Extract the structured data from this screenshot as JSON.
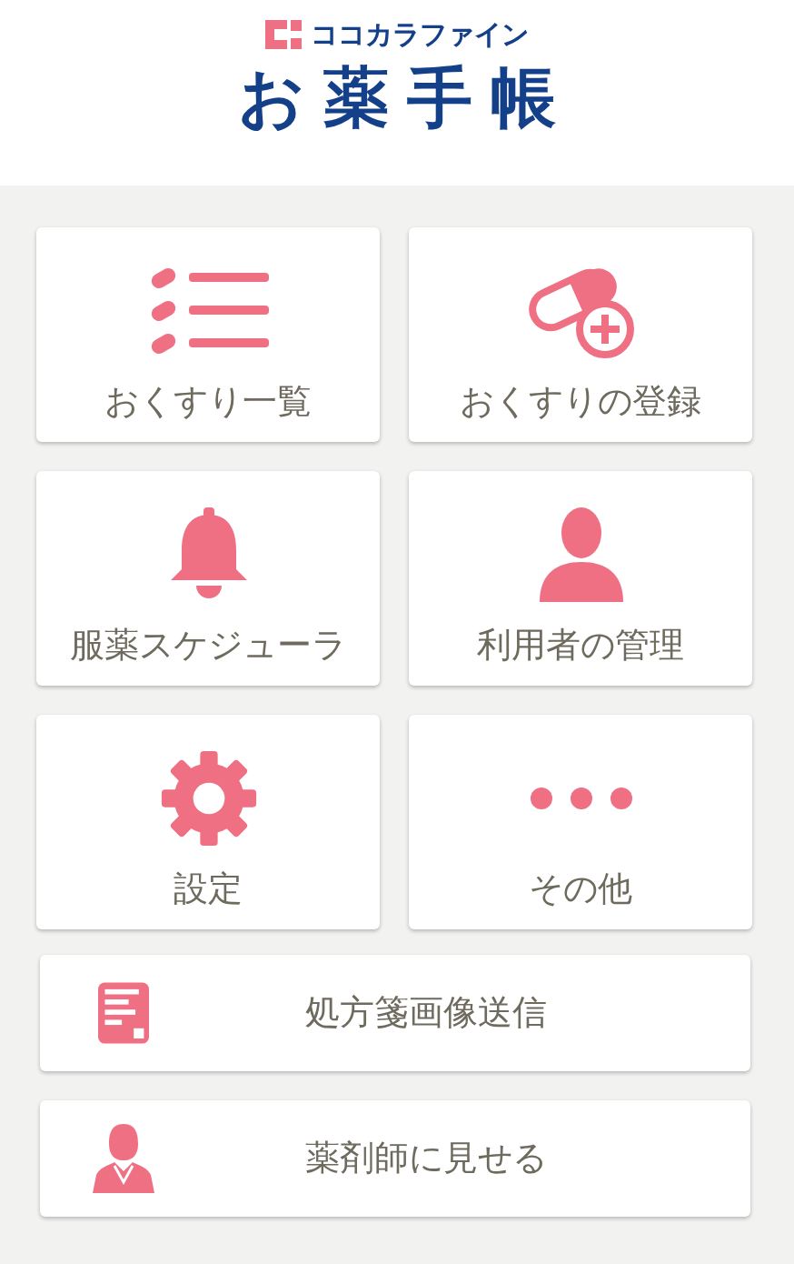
{
  "header": {
    "brand": "ココカラファイン",
    "title": "お薬手帳"
  },
  "tiles": [
    {
      "label": "おくすり一覧",
      "kind": "list"
    },
    {
      "label": "おくすりの登録",
      "kind": "register"
    },
    {
      "label": "服薬スケジューラ",
      "kind": "alarm"
    },
    {
      "label": "利用者の管理",
      "kind": "users"
    },
    {
      "label": "設定",
      "kind": "settings"
    },
    {
      "label": "その他",
      "kind": "more"
    }
  ],
  "wide_buttons": [
    {
      "label": "処方箋画像送信",
      "kind": "prescription"
    },
    {
      "label": "薬剤師に見せる",
      "kind": "pharmacist"
    }
  ]
}
